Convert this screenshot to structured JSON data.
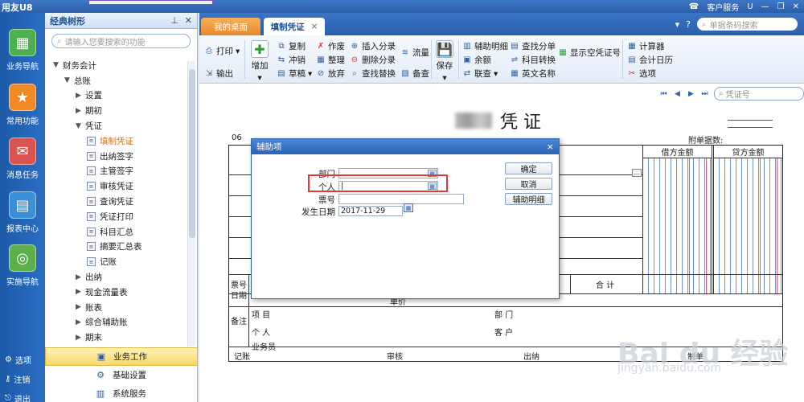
{
  "app": {
    "brand": "用友U8",
    "service": "客户服务",
    "u_mark": "U"
  },
  "rail": {
    "items": [
      {
        "label": "业务导航",
        "icon": "grid-icon",
        "color": "#4caf50"
      },
      {
        "label": "常用功能",
        "icon": "star-icon",
        "color": "#f08a24"
      },
      {
        "label": "消息任务",
        "icon": "mail-icon",
        "color": "#d9534f"
      },
      {
        "label": "报表中心",
        "icon": "report-icon",
        "color": "#3b8fd8"
      },
      {
        "label": "实施导航",
        "icon": "compass-icon",
        "color": "#5bb04a"
      }
    ],
    "bottom": [
      "选项",
      "注销",
      "退出"
    ]
  },
  "tree": {
    "title": "经典树形",
    "search_placeholder": "请输入您要搜索的功能",
    "nodes": [
      {
        "label": "财务会计",
        "arrow": "▼",
        "indent": 0
      },
      {
        "label": "总账",
        "arrow": "▼",
        "indent": 1
      },
      {
        "label": "设置",
        "arrow": "▶",
        "indent": 2
      },
      {
        "label": "期初",
        "arrow": "▶",
        "indent": 2
      },
      {
        "label": "凭证",
        "arrow": "▼",
        "indent": 2
      },
      {
        "label": "填制凭证",
        "doc": true,
        "indent": 3,
        "selected": true
      },
      {
        "label": "出纳签字",
        "doc": true,
        "indent": 3
      },
      {
        "label": "主管签字",
        "doc": true,
        "indent": 3
      },
      {
        "label": "审核凭证",
        "doc": true,
        "indent": 3
      },
      {
        "label": "查询凭证",
        "doc": true,
        "indent": 3
      },
      {
        "label": "凭证打印",
        "doc": true,
        "indent": 3
      },
      {
        "label": "科目汇总",
        "doc": true,
        "indent": 3
      },
      {
        "label": "摘要汇总表",
        "doc": true,
        "indent": 3
      },
      {
        "label": "记账",
        "doc": true,
        "indent": 3
      },
      {
        "label": "出纳",
        "arrow": "▶",
        "indent": 2
      },
      {
        "label": "现金流量表",
        "arrow": "▶",
        "indent": 2
      },
      {
        "label": "账表",
        "arrow": "▶",
        "indent": 2
      },
      {
        "label": "综合辅助账",
        "arrow": "▶",
        "indent": 2
      },
      {
        "label": "期末",
        "arrow": "▶",
        "indent": 2
      }
    ],
    "footer": [
      "业务工作",
      "基础设置",
      "系统服务"
    ]
  },
  "tabs": {
    "home": "我的桌面",
    "current": "填制凭证",
    "barcode_placeholder": "单据条码搜索"
  },
  "toolbar": {
    "print": "打印",
    "output": "输出",
    "add": "增加",
    "copy": "复制",
    "red": "冲销",
    "draft": "草稿",
    "void": "作废",
    "organize": "整理",
    "discard": "放弃",
    "insert": "插入分录",
    "delete": "删除分录",
    "find_replace": "查找替换",
    "flow": "流量",
    "note": "备查",
    "save": "保存",
    "aux_detail": "辅助明细",
    "balance": "余额",
    "link": "联查",
    "find_entry": "查找分单",
    "subject_convert": "科目转换",
    "english": "英文名称",
    "show_empty": "显示空凭证号",
    "calculator": "计算器",
    "calendar": "会计日历",
    "options": "选项"
  },
  "voucher": {
    "title": "凭 证",
    "search_placeholder": "凭证号",
    "attachments": "附单据数:",
    "code": "06",
    "debit": "借方金额",
    "credit": "贷方金额",
    "ticket_no": "票号",
    "date": "日期",
    "total": "合 计",
    "unit": "单价",
    "remarks": "备注",
    "project": "项 目",
    "dept": "部 门",
    "person": "个 人",
    "customer": "客 户",
    "salesman": "业务员",
    "bookkeeper": "记账",
    "reviewer": "审核",
    "cashier": "出纳",
    "maker": "制单",
    "watermark": "Bai du 经验",
    "watermark_url": "jingyan.baidu.com"
  },
  "dialog": {
    "title": "辅助项",
    "close": "×",
    "fields": {
      "dept": "部门",
      "person": "个人",
      "ticket": "票号",
      "date": "发生日期",
      "date_value": "2017-11-29"
    },
    "buttons": {
      "ok": "确定",
      "cancel": "取消",
      "detail": "辅助明细"
    }
  }
}
